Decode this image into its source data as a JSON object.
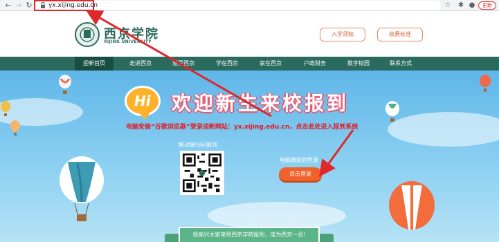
{
  "browser": {
    "url": "yx.xijing.edu.cn",
    "update_label": "更新"
  },
  "header": {
    "logo_cn": "西京学院",
    "logo_en": "XIJING UNIVERSITY",
    "buttons": [
      "入学须知",
      "收费标准"
    ]
  },
  "nav": {
    "items": [
      "迎新首页",
      "走进西京",
      "感受西京",
      "学在西京",
      "家在西京",
      "户政财务",
      "数字校园",
      "联系方式"
    ],
    "active_index": 0
  },
  "hero": {
    "hi": "Hi",
    "welcome": "欢迎新生来校报到",
    "instruction": "电脑安装“谷歌浏览器”登录迎新网站：yx.xijing.edu.cn，点击此处进入报到系统",
    "qr_label": "移动端扫码报到",
    "pc_label": "电脑端报到登录",
    "login_button": "点击登录",
    "bottom_banner": "很高兴大家来到西京学院报到，成为西京一员!"
  },
  "colors": {
    "nav_bg": "#2b6b5f",
    "brand_green": "#2d6b5c",
    "login_orange": "#f0622c",
    "annotation_red": "#e0272a",
    "instruction_red": "#e31b25"
  },
  "icons": [
    "back-arrow-icon",
    "forward-arrow-icon",
    "reload-icon",
    "lock-icon",
    "star-icon",
    "extension-icon",
    "account-icon"
  ]
}
